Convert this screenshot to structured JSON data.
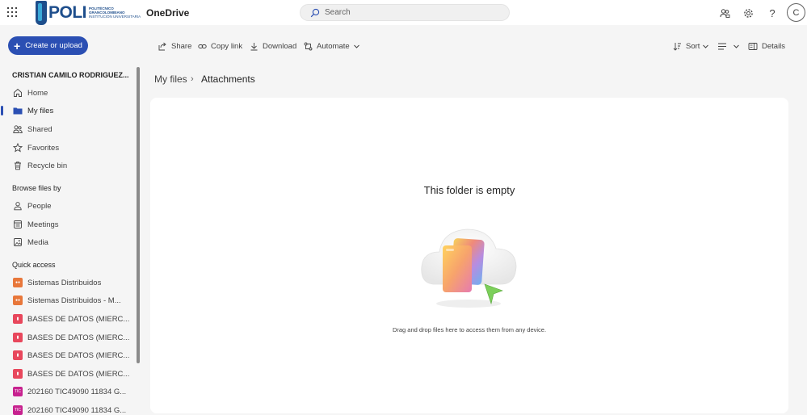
{
  "app": {
    "name": "OneDrive",
    "logo_text": "POLI",
    "logo_sub": [
      "POLITÉCNICO",
      "GRANCOLOMBIANO",
      "INSTITUCIÓN UNIVERSITARIA"
    ]
  },
  "search": {
    "placeholder": "Search"
  },
  "header_icons": [
    "share-people-icon",
    "gear-icon",
    "help-icon"
  ],
  "avatar_initial": "C",
  "create_button": "Create or upload",
  "user_name": "CRISTIAN CAMILO RODRIGUEZ...",
  "nav": [
    {
      "label": "Home",
      "icon": "home-icon"
    },
    {
      "label": "My files",
      "icon": "folder-icon",
      "active": true
    },
    {
      "label": "Shared",
      "icon": "people-icon"
    },
    {
      "label": "Favorites",
      "icon": "star-icon"
    },
    {
      "label": "Recycle bin",
      "icon": "trash-icon"
    }
  ],
  "browse_heading": "Browse files by",
  "browse": [
    {
      "label": "People",
      "icon": "person-icon"
    },
    {
      "label": "Meetings",
      "icon": "calendar-icon"
    },
    {
      "label": "Media",
      "icon": "image-icon"
    }
  ],
  "quick_access_heading": "Quick access",
  "quick_access": [
    {
      "label": "Sistemas Distribuidos",
      "color": "#e8773a"
    },
    {
      "label": "Sistemas Distribuidos - M...",
      "color": "#e8773a"
    },
    {
      "label": "BASES DE DATOS (MIERC...",
      "color": "#e8475c"
    },
    {
      "label": "BASES DE DATOS (MIERC...",
      "color": "#e8475c"
    },
    {
      "label": "BASES DE DATOS (MIERC...",
      "color": "#e8475c"
    },
    {
      "label": "BASES DE DATOS (MIERC...",
      "color": "#e8475c"
    },
    {
      "label": "202160 TIC49090 11834 G...",
      "color": "#c7228f"
    },
    {
      "label": "202160 TIC49090 11834 G...",
      "color": "#c7228f"
    }
  ],
  "toolbar": {
    "share": "Share",
    "copy_link": "Copy link",
    "download": "Download",
    "automate": "Automate",
    "sort": "Sort",
    "details": "Details"
  },
  "breadcrumb": {
    "parent": "My files",
    "separator": "›",
    "current": "Attachments"
  },
  "empty_state": {
    "title": "This folder is empty",
    "subtitle": "Drag and drop files here to access them from any device."
  },
  "colors": {
    "accent": "#2b4fb3",
    "brand": "#1e4e8c"
  }
}
